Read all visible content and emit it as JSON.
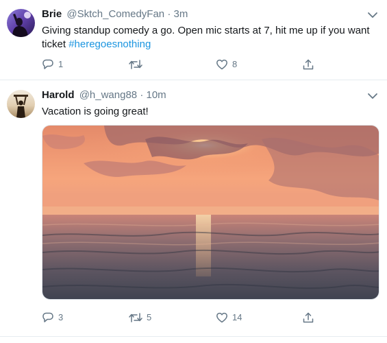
{
  "tweets": [
    {
      "name": "Brie",
      "handle": "@Sktch_ComedyFan",
      "separator": "·",
      "time": "3m",
      "text": "Giving standup comedy a go. Open mic starts at 7, hit me up if you want ticket ",
      "hashtag": "#heregoesnothing",
      "replies": "1",
      "retweets": "",
      "likes": "8"
    },
    {
      "name": "Harold",
      "handle": "@h_wang88",
      "separator": "·",
      "time": "10m",
      "text": "Vacation is going great!",
      "replies": "3",
      "retweets": "5",
      "likes": "14"
    }
  ],
  "icons": {
    "reply": "reply-icon",
    "retweet": "retweet-icon",
    "like": "heart-icon",
    "share": "share-icon",
    "more": "chevron-down-icon"
  },
  "colors": {
    "link": "#1b95e0",
    "muted": "#657786",
    "divider": "#e6ecf0"
  }
}
